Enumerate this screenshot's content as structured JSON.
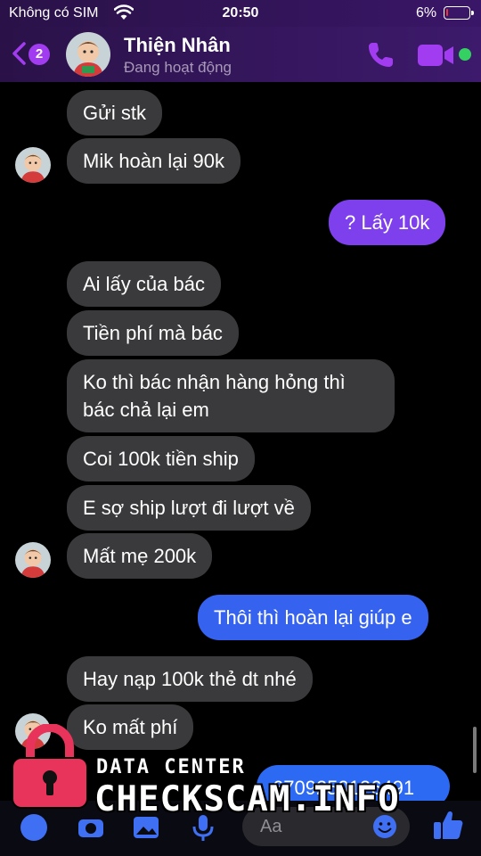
{
  "status_bar": {
    "carrier": "Không có SIM",
    "time": "20:50",
    "battery_percent": "6%",
    "battery_level": 0.06,
    "battery_color": "#ee3333"
  },
  "header": {
    "back_badge": "2",
    "contact_name": "Thiện Nhân",
    "contact_status": "Đang hoạt động",
    "accent_color": "#a23cf0",
    "online_color": "#35d062"
  },
  "messages": [
    {
      "direction": "in",
      "text": "Gửi stk"
    },
    {
      "direction": "in",
      "text": "Mik hoàn lại 90k"
    },
    {
      "direction": "out",
      "text": "? Lấy 10k"
    },
    {
      "direction": "in",
      "text": "Ai lấy của bác"
    },
    {
      "direction": "in",
      "text": "Tiền phí mà bác"
    },
    {
      "direction": "in",
      "text": "Ko thì bác nhận hàng hỏng thì bác chả lại em"
    },
    {
      "direction": "in",
      "text": "Coi 100k tiền ship"
    },
    {
      "direction": "in",
      "text": "E sợ ship lượt đi lượt về"
    },
    {
      "direction": "in",
      "text": "Mất mẹ 200k"
    },
    {
      "direction": "out",
      "text": "Thôi thì hoàn lại giúp e"
    },
    {
      "direction": "in",
      "text": "Hay nạp 100k thẻ dt nhé"
    },
    {
      "direction": "in",
      "text": "Ko mất phí"
    },
    {
      "direction": "out",
      "text": "67092501264​91"
    }
  ],
  "composer": {
    "placeholder": "Aa",
    "icons": [
      "grid-icon",
      "camera-icon",
      "image-icon",
      "microphone-icon",
      "emoji-icon",
      "thumbs-up-icon"
    ]
  },
  "watermark": {
    "top": "DATA CENTER",
    "main": "CHECKSCAM.INFO"
  }
}
